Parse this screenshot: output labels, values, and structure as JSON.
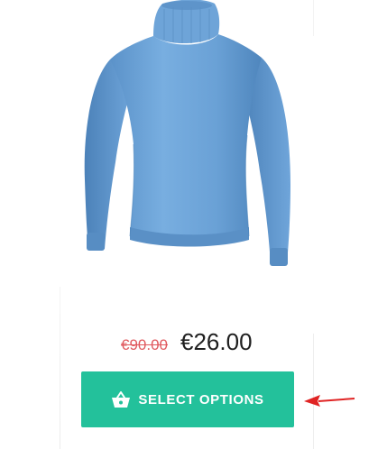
{
  "product": {
    "image_alt": "Light blue turtleneck sweater",
    "old_price": "€90.00",
    "new_price": "€26.00"
  },
  "cta": {
    "label": "SELECT OPTIONS",
    "icon": "basket-icon"
  },
  "annotation": {
    "icon": "red-arrow-icon"
  },
  "colors": {
    "button": "#23c19b",
    "old_price": "#e0595e",
    "sweater": "#6a9fd4",
    "arrow": "#e02424"
  }
}
